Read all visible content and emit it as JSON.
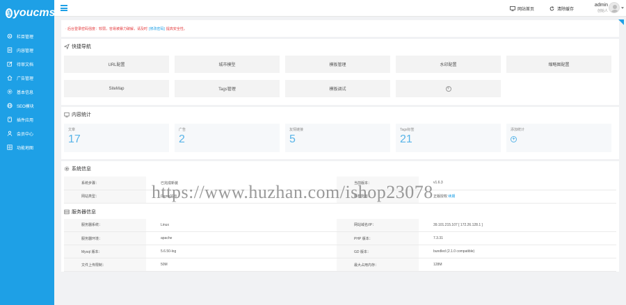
{
  "app": {
    "logo_letter": "E",
    "logo_text": "youcms"
  },
  "colors": {
    "primary": "#1ea0e6",
    "notice_red": "#e4393c",
    "stat_blue": "#58b4e8"
  },
  "sidebar": {
    "items": [
      {
        "label": "栏目管理",
        "icon": "gear-icon"
      },
      {
        "label": "内容管理",
        "icon": "document-icon"
      },
      {
        "label": "待审文档",
        "icon": "edit-icon"
      },
      {
        "label": "广告管理",
        "icon": "home-icon"
      },
      {
        "label": "基本信息",
        "icon": "settings-icon"
      },
      {
        "label": "SEO模块",
        "icon": "globe-icon"
      },
      {
        "label": "插件应用",
        "icon": "plug-icon"
      },
      {
        "label": "会员中心",
        "icon": "user-icon"
      },
      {
        "label": "功能地图",
        "icon": "grid-icon"
      }
    ]
  },
  "topbar": {
    "site_home": "网站首页",
    "clear_cache": "清除缓存",
    "admin_name": "admin",
    "admin_role": "创始人"
  },
  "notice": {
    "text": "· 后台登录密码强度：较弱，容易被暴力破解，请及时",
    "link": "[修改密码]",
    "text2": "提高安全性。"
  },
  "quick_nav": {
    "title": "快捷导航",
    "items": [
      "URL配置",
      "城市模型",
      "模板管理",
      "水印配置",
      "缩略图配置",
      "SiteMap",
      "Tags管理",
      "模板调试"
    ]
  },
  "stats": {
    "title": "内容统计",
    "items": [
      {
        "label": "文章",
        "value": "17"
      },
      {
        "label": "广告",
        "value": "2"
      },
      {
        "label": "友情链接",
        "value": "5"
      },
      {
        "label": "Tags标签",
        "value": "21"
      },
      {
        "label": "添加统计",
        "value": ""
      }
    ]
  },
  "system_info": {
    "title": "系统信息",
    "rows": [
      {
        "l1": "系统步骤：",
        "v1": "已完成新装",
        "l2": "当前版本：",
        "v2": "v1.6.3",
        "link": ""
      },
      {
        "l1": "网站类型：",
        "v1": "Demo站点",
        "l2": "版权所有：",
        "v2": "正版授权",
        "link": "续期"
      }
    ]
  },
  "server_info": {
    "title": "服务器信息",
    "rows": [
      {
        "l1": "服务器系统：",
        "v1": "Linux",
        "l2": "网站域名/IP：",
        "v2": "39.101.215.107 [ 172.26.128.1 ]"
      },
      {
        "l1": "服务器环境：",
        "v1": "apache",
        "l2": "PHP 版本：",
        "v2": "7.3.31"
      },
      {
        "l1": "Mysql 版本：",
        "v1": "5.6.50-log",
        "l2": "GD 版本：",
        "v2": "bundled (2.1.0 compatible)"
      },
      {
        "l1": "文件上传限制：",
        "v1": "50M",
        "l2": "最大占用内存：",
        "v2": "128M"
      }
    ]
  },
  "watermark": "https://www.huzhan.com/ishop23078"
}
